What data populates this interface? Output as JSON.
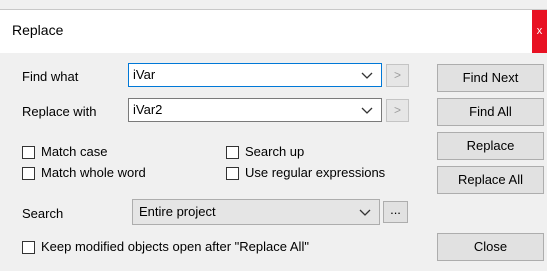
{
  "dialog": {
    "title": "Replace",
    "close_glyph": "x"
  },
  "find": {
    "label": "Find what",
    "value": "iVar",
    "next_arrow": ">"
  },
  "replace": {
    "label": "Replace with",
    "value": "iVar2",
    "next_arrow": ">"
  },
  "options": {
    "match_case": {
      "label": "Match case",
      "checked": false
    },
    "match_whole_word": {
      "label": "Match whole word",
      "checked": false
    },
    "search_up": {
      "label": "Search up",
      "checked": false
    },
    "use_regex": {
      "label": "Use regular expressions",
      "checked": false
    }
  },
  "search": {
    "label": "Search",
    "value": "Entire project",
    "browse_label": "..."
  },
  "keep_open": {
    "label": "Keep modified objects open after \"Replace All\"",
    "checked": false
  },
  "buttons": {
    "find_next": "Find Next",
    "find_all": "Find All",
    "replace": "Replace",
    "replace_all": "Replace All",
    "close": "Close"
  },
  "icons": {
    "dropdown": "chevron-down-icon",
    "close": "close-icon"
  },
  "colors": {
    "close_bg": "#e81123",
    "focus_border": "#0078d7"
  }
}
